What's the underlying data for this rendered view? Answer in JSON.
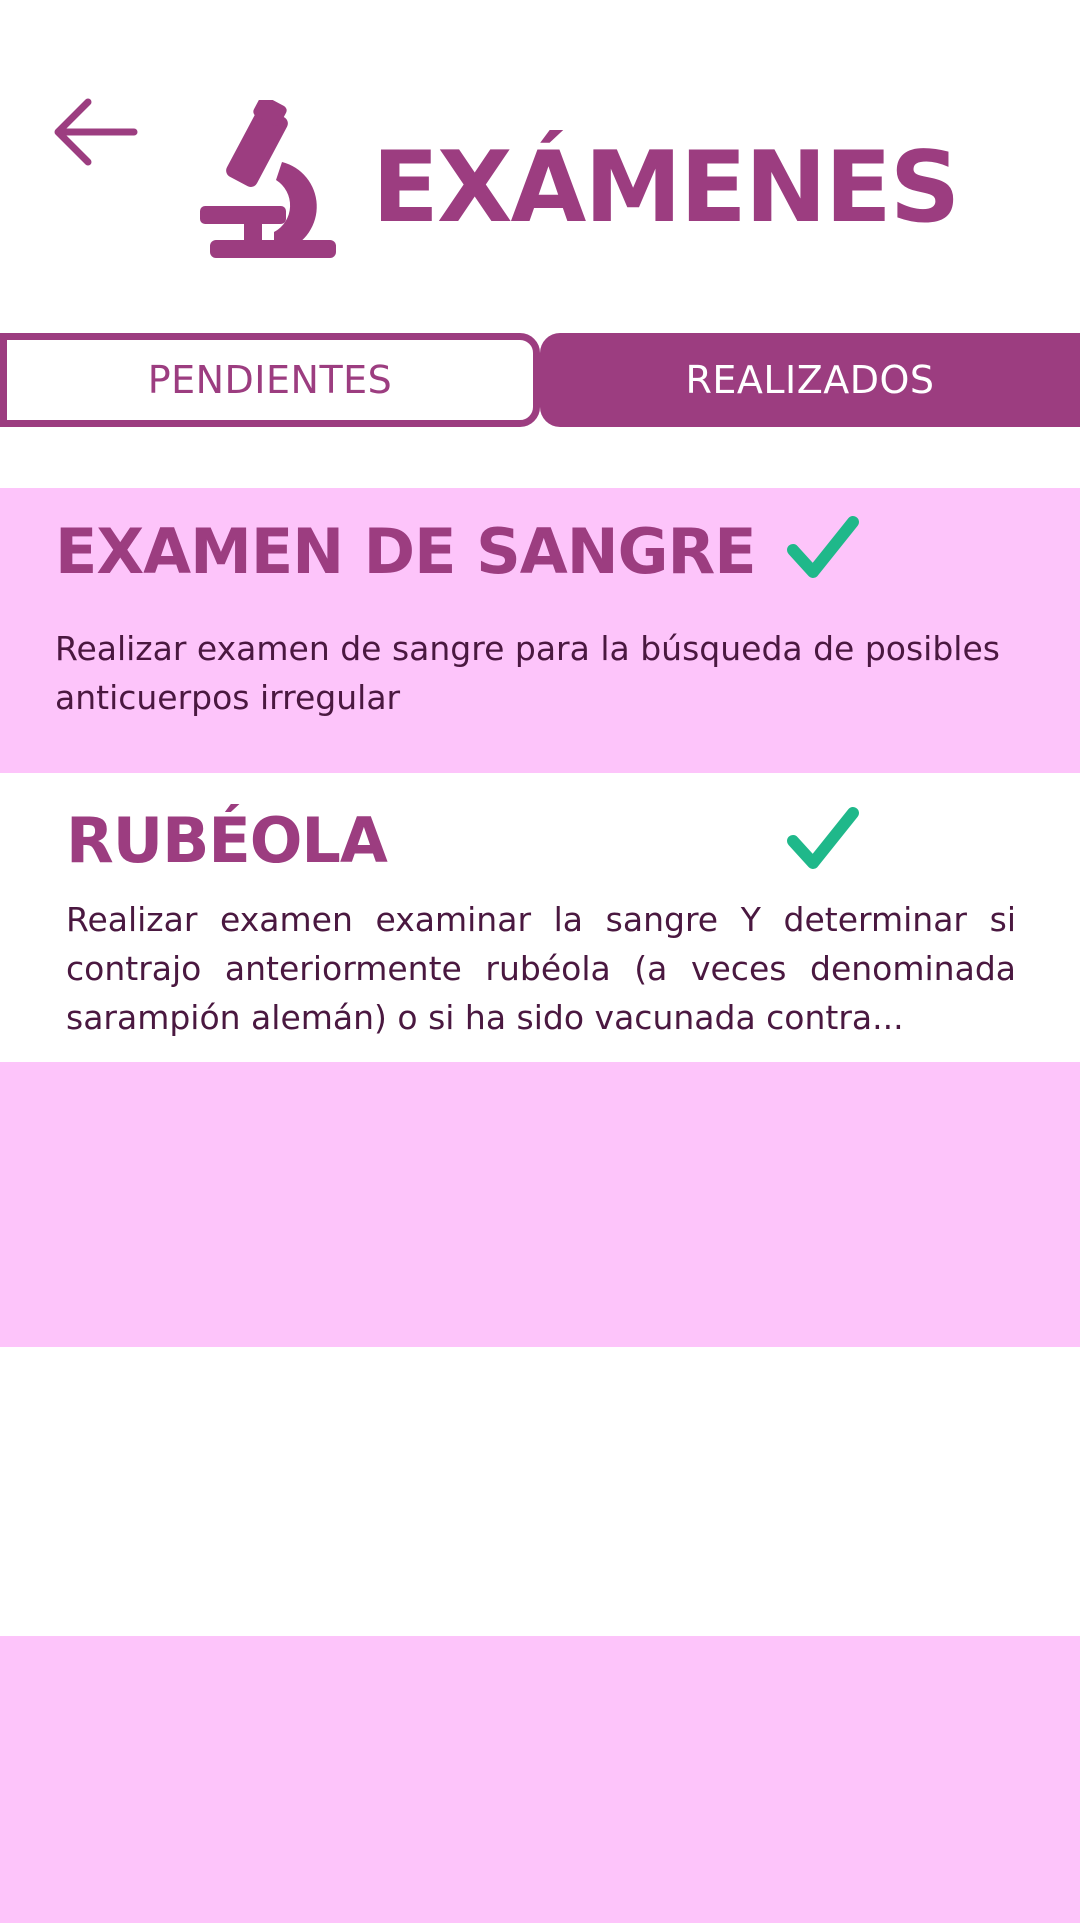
{
  "header": {
    "back_icon": "arrow-left-icon",
    "title_icon": "microscope-icon",
    "title": "EXÁMENES"
  },
  "tabs": [
    {
      "label": "PENDIENTES",
      "active": false
    },
    {
      "label": "REALIZADOS",
      "active": true
    }
  ],
  "exams": [
    {
      "title": "EXAMEN DE SANGRE",
      "description": "Realizar examen de sangre para la búsqueda de posibles anticuerpos irregular",
      "status_icon": "check-icon"
    },
    {
      "title": "RUBÉOLA",
      "description": "Realizar examen examinar la sangre Y determinar si contrajo anteriormente rubéola (a veces denominada sarampión alemán) o si ha sido vacunada contra...",
      "status_icon": "check-icon"
    }
  ],
  "colors": {
    "primary": "#9c3d80",
    "band_pink": "#fdc4fa",
    "check_green": "#1fb88a",
    "text_dark": "#4a1840",
    "background": "#ffffff"
  }
}
